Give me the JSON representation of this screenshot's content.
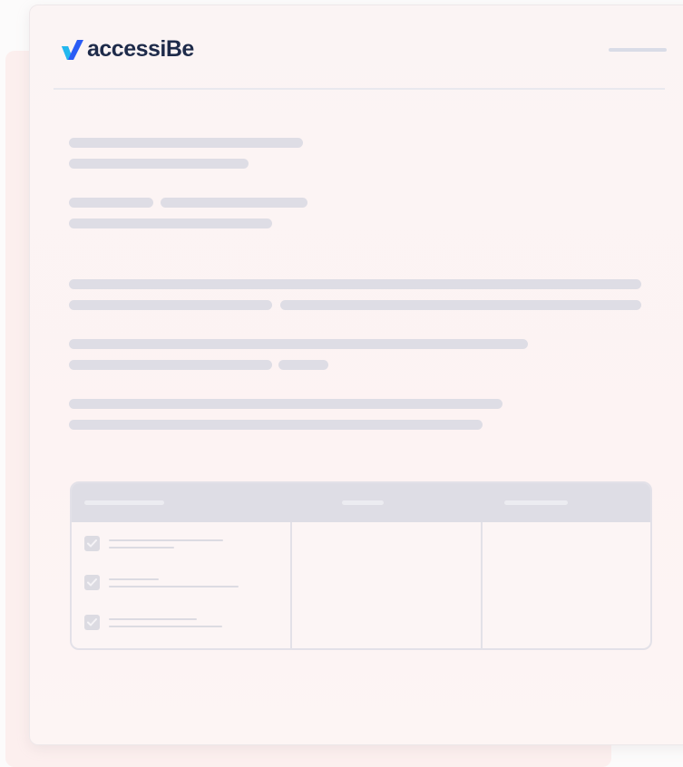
{
  "brand": {
    "name": "accessiBe",
    "logo_mark": "check-mark-logo",
    "colors": {
      "logo_text": "#1e2b4a",
      "logo_mark_primary": "#2a5cf5",
      "logo_mark_secondary": "#22b8ee"
    }
  },
  "icons": {
    "checkbox": "check-icon",
    "menu": "menu-line-icon"
  },
  "placeholder_color": "#dedde5"
}
